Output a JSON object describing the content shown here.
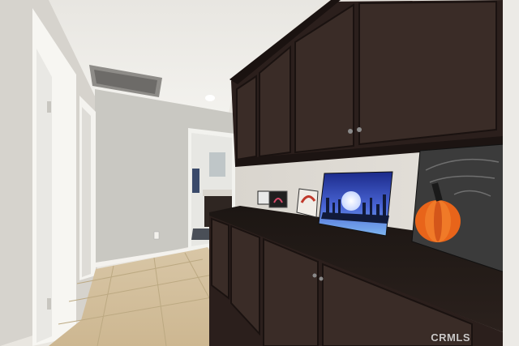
{
  "photo": {
    "watermark": "CRMLS"
  }
}
